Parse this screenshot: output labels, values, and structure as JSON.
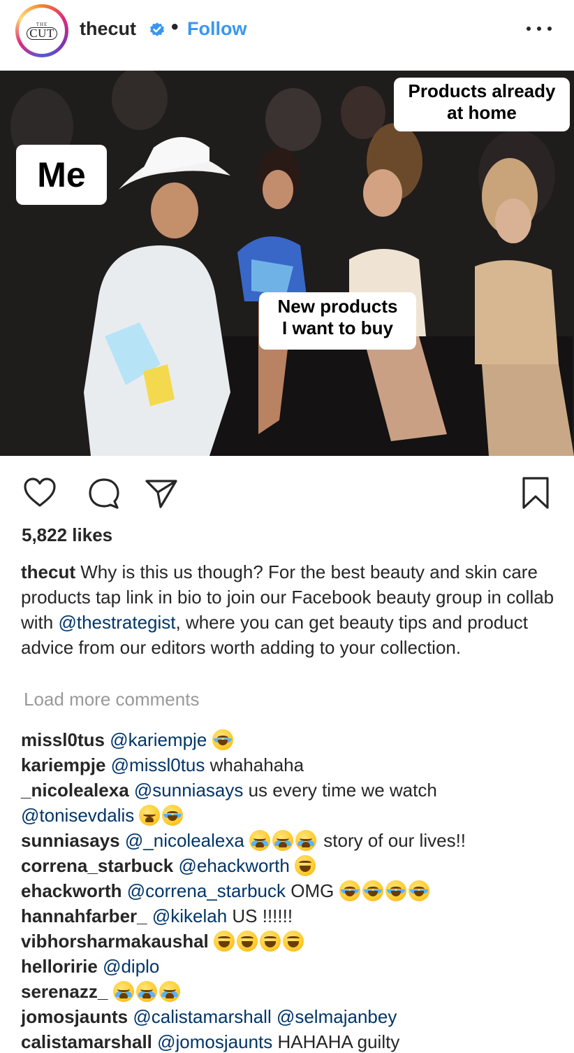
{
  "header": {
    "avatar_top_text": "THE",
    "avatar_main_text": "CUT",
    "username": "thecut",
    "separator": "•",
    "follow_label": "Follow",
    "verified_icon": "verified-badge-icon",
    "more_icon": "more-options-icon"
  },
  "photo": {
    "label_me": "Me",
    "label_home_line1": "Products already",
    "label_home_line2": "at home",
    "label_new_line1": "New products",
    "label_new_line2": "I want to buy"
  },
  "actions": {
    "icons": [
      "heart-icon",
      "comment-icon",
      "share-icon",
      "bookmark-icon"
    ]
  },
  "likes": "5,822 likes",
  "caption": {
    "username": "thecut",
    "text_before": " Why is this us though? For the best beauty and skin care products tap link in bio to join our Facebook beauty group in collab with ",
    "mention": "@thestrategist",
    "text_after": ", where you can get beauty tips and product advice from our editors worth adding to your collection."
  },
  "load_more_label": "Load more comments",
  "comments": [
    {
      "user": "missl0tus",
      "mention": "@kariempje",
      "text": "",
      "emojis": [
        "joy"
      ]
    },
    {
      "user": "kariempje",
      "mention": "@missl0tus",
      "text": " whahahaha",
      "emojis": []
    },
    {
      "user": "_nicolealexa",
      "mention": "@sunniasays",
      "text": " us every time we watch ",
      "mention2": "@tonisevdalis",
      "emojis": [
        "weary",
        "joy"
      ]
    },
    {
      "user": "sunniasays",
      "mention": "@_nicolealexa",
      "text": "",
      "emojis": [
        "cry",
        "cry",
        "cry"
      ],
      "text_end": " story of our lives!!"
    },
    {
      "user": "correna_starbuck",
      "mention": "@ehackworth",
      "text": "",
      "emojis": [
        "laugh"
      ]
    },
    {
      "user": "ehackworth",
      "mention": "@correna_starbuck",
      "text": " OMG",
      "emojis": [
        "joy",
        "joy",
        "joy",
        "joy"
      ]
    },
    {
      "user": "hannahfarber_",
      "mention": "@kikelah",
      "text": " US !!!!!!",
      "emojis": []
    },
    {
      "user": "vibhorsharmakaushal",
      "mention": "",
      "text": "",
      "emojis": [
        "laugh",
        "laugh",
        "laugh",
        "laugh"
      ]
    },
    {
      "user": "hellorirée",
      "mention": "@diplo",
      "text": "",
      "emojis": []
    },
    {
      "user": "serenazz_",
      "mention": "",
      "text": "",
      "emojis": [
        "cry",
        "cry",
        "cry"
      ]
    },
    {
      "user": "jomosjaunts",
      "mention": "@calistamarshall",
      "text": " ",
      "mention2": "@selmajanbey",
      "emojis": []
    },
    {
      "user": "calistamarshall",
      "mention": "@jomosjaunts",
      "text": " HAHAHA guilty",
      "emojis": []
    }
  ],
  "colors": {
    "link_blue": "#3897f0",
    "mention_blue": "#003569",
    "muted_gray": "#999999",
    "text": "#262626"
  }
}
